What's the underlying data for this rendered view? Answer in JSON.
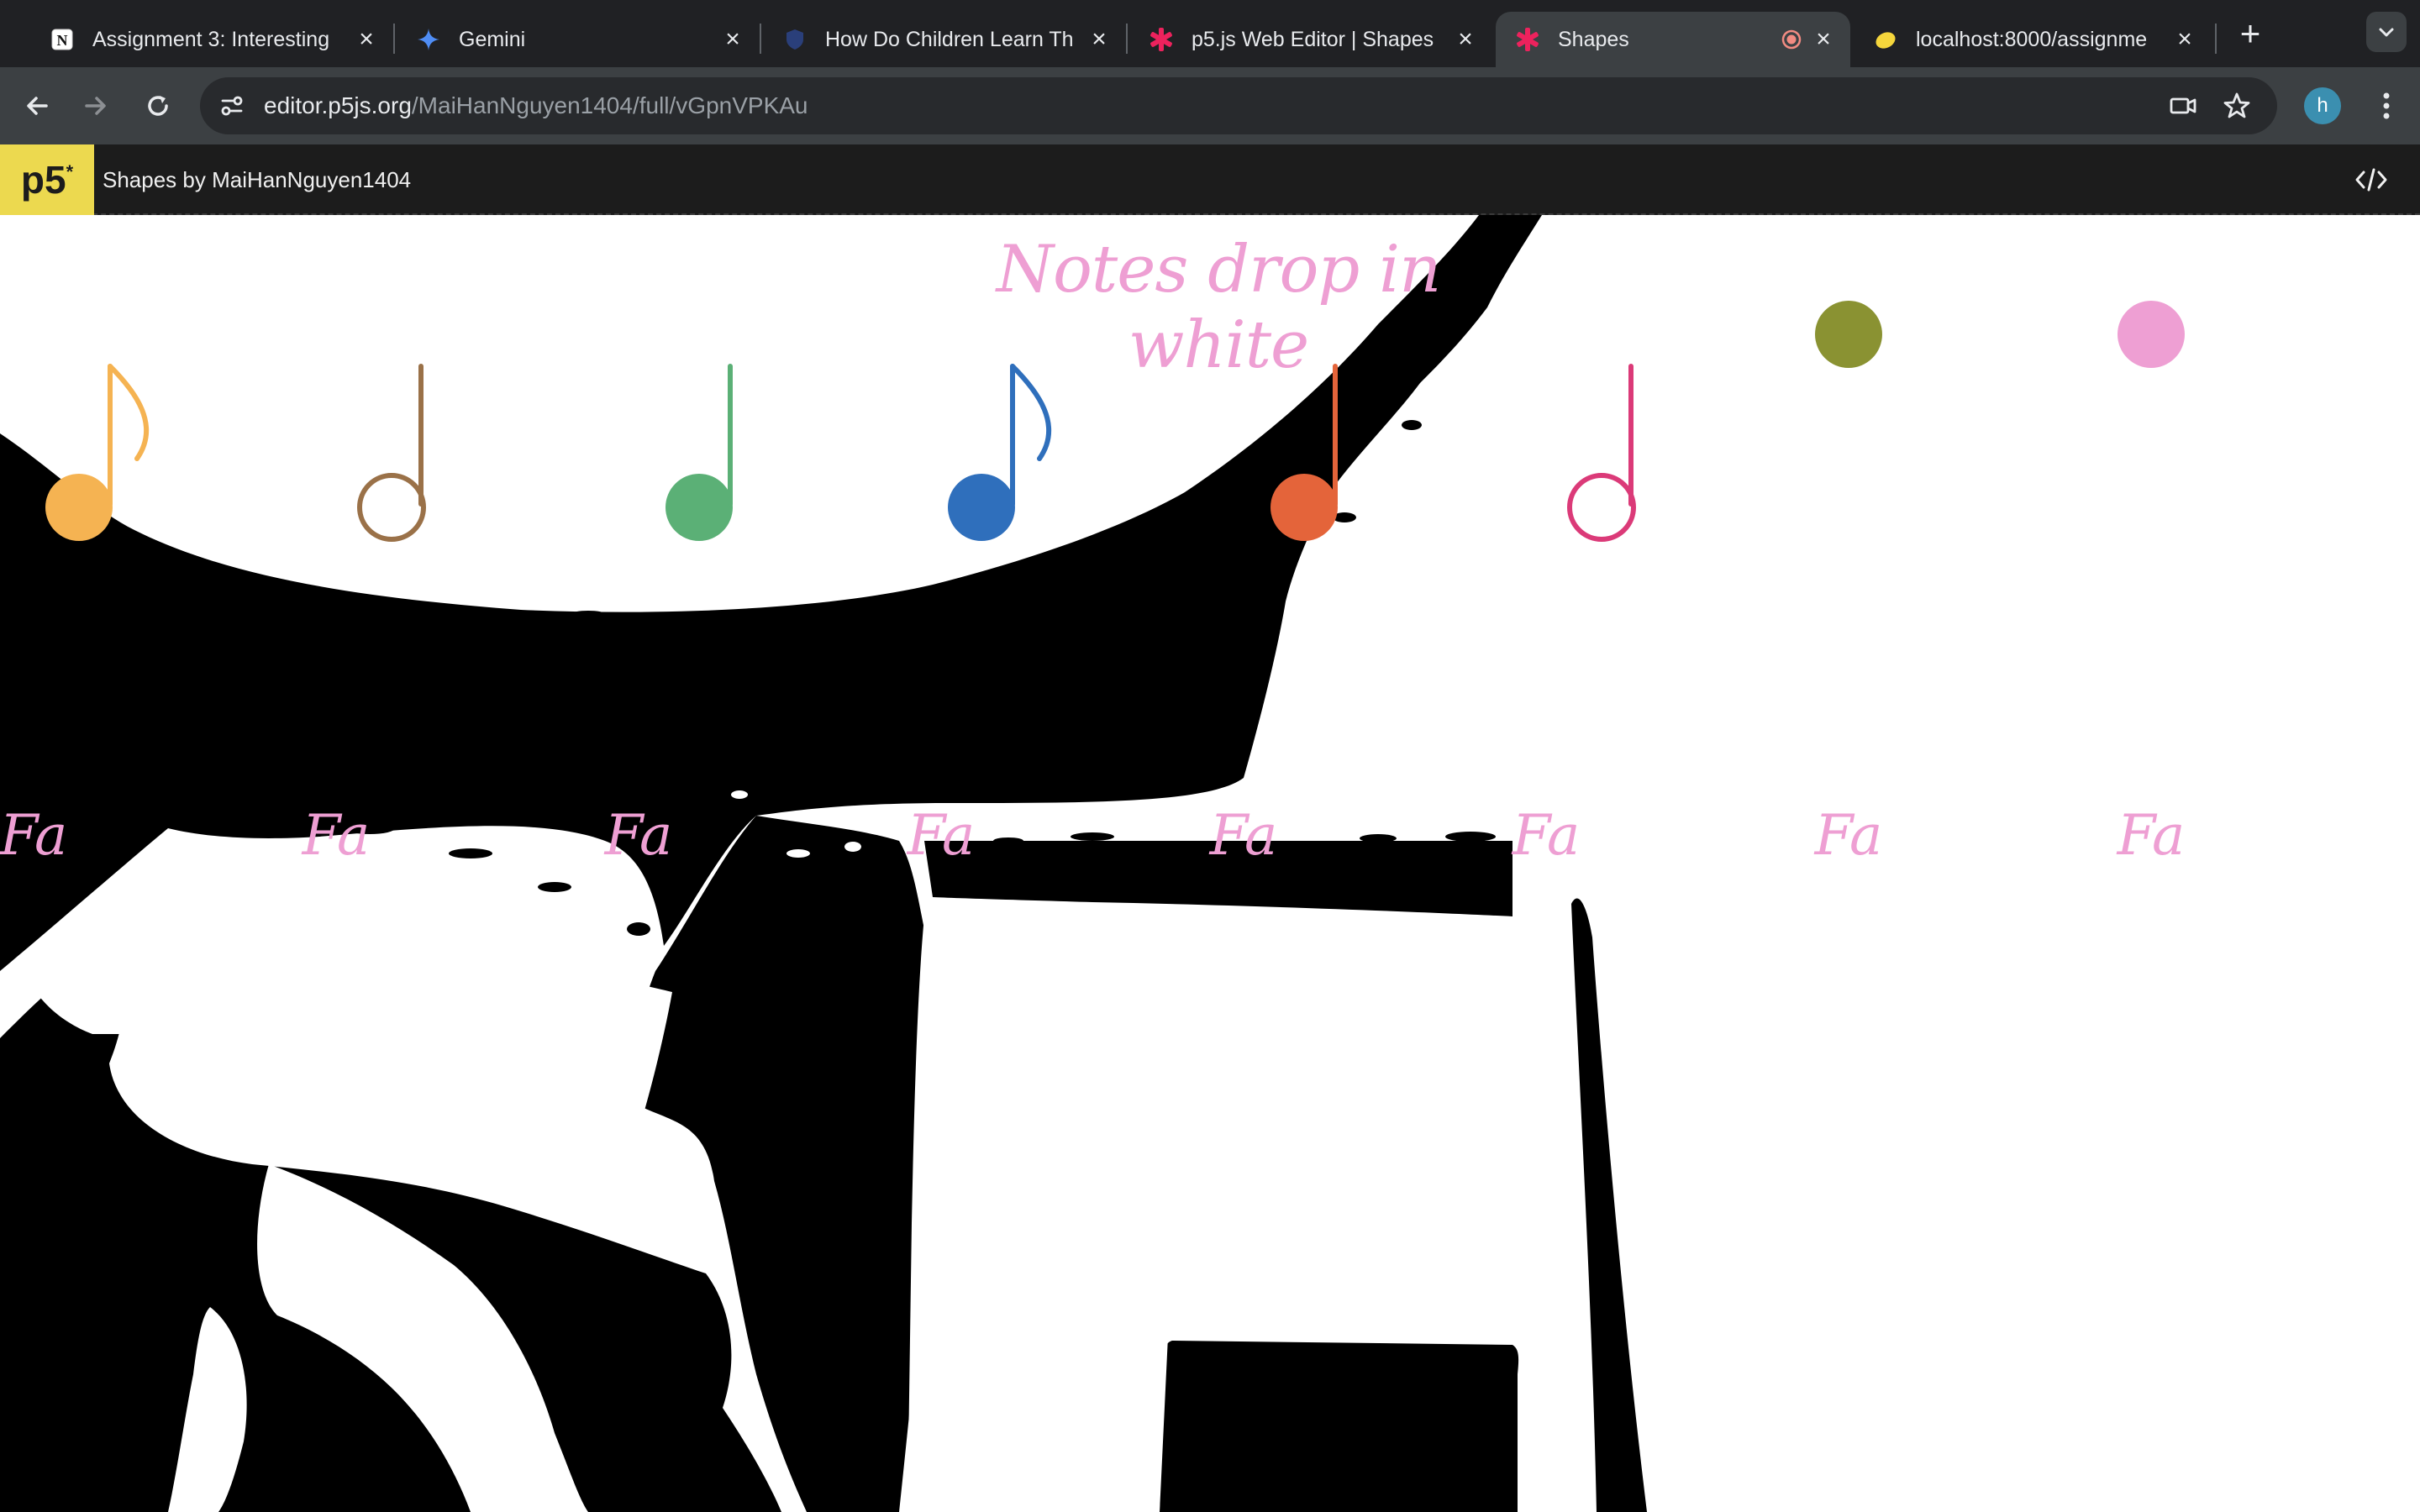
{
  "browser": {
    "tabs": [
      {
        "title": "Assignment 3: Interesting",
        "favicon": "notion-icon",
        "active": false
      },
      {
        "title": "Gemini",
        "favicon": "gemini-sparkle-icon",
        "active": false
      },
      {
        "title": "How Do Children Learn Th",
        "favicon": "shield-icon",
        "active": false
      },
      {
        "title": "p5.js Web Editor | Shapes",
        "favicon": "p5-asterisk-icon",
        "active": false
      },
      {
        "title": "Shapes",
        "favicon": "p5-asterisk-icon",
        "active": true,
        "recording": true
      },
      {
        "title": "localhost:8000/assignme",
        "favicon": "lemon-icon",
        "active": false
      }
    ],
    "url_host": "editor.p5js.org",
    "url_path": "/MaiHanNguyen1404/full/vGpnVPKAu",
    "profile_initial": "h"
  },
  "p5": {
    "logo": "p5",
    "logo_mark": "*",
    "sketch_title": "Shapes by MaiHanNguyen1404"
  },
  "sketch": {
    "heading": "Notes drop in white",
    "syllable": "Fa",
    "notes": [
      {
        "type": "eighth",
        "fill": "#f5b352",
        "stroke": "#f5b352"
      },
      {
        "type": "half",
        "fill": "none",
        "stroke": "#9a7148"
      },
      {
        "type": "quarter",
        "fill": "#5bb076",
        "stroke": "#5bb076"
      },
      {
        "type": "eighth",
        "fill": "#2f6fbc",
        "stroke": "#2f6fbc"
      },
      {
        "type": "quarter",
        "fill": "#e4643a",
        "stroke": "#e4643a"
      },
      {
        "type": "half",
        "fill": "none",
        "stroke": "#db3a78"
      },
      {
        "type": "dot",
        "fill": "#8a9232",
        "stroke": "none"
      },
      {
        "type": "dot",
        "fill": "#ee9fd3",
        "stroke": "none"
      }
    ]
  }
}
